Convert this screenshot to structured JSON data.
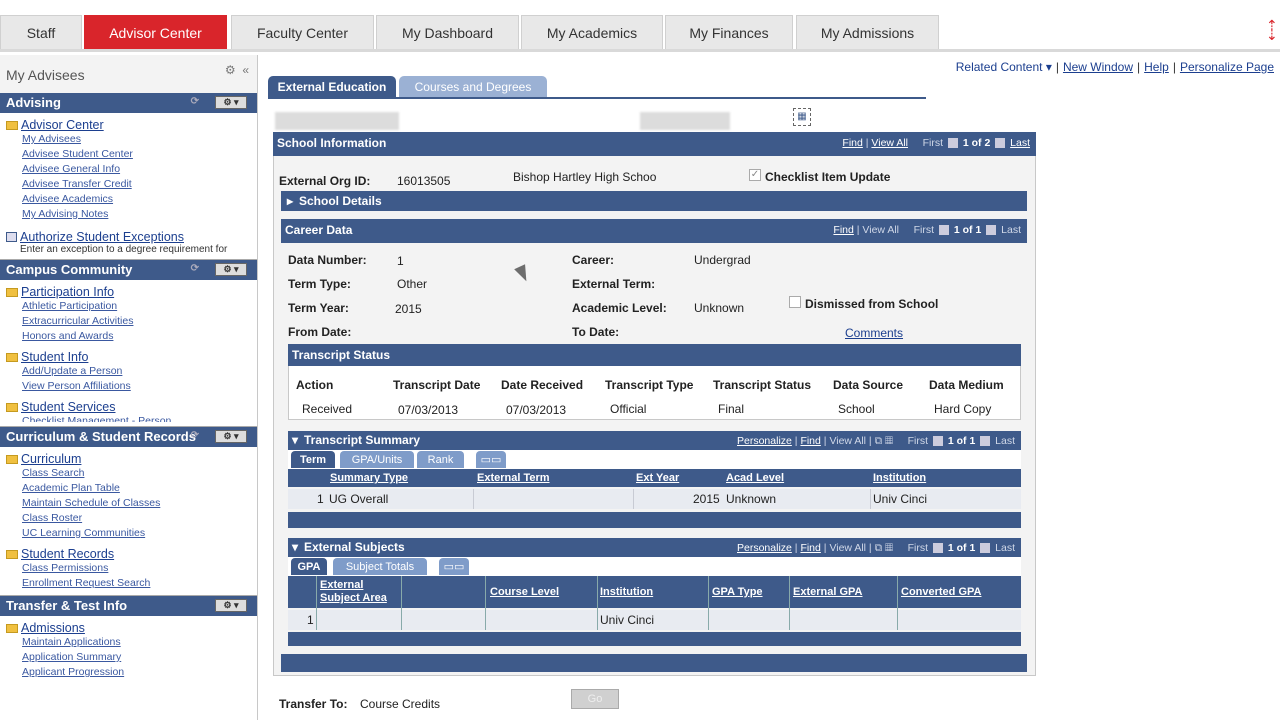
{
  "top_tabs": [
    "Staff",
    "Advisor Center",
    "Faculty Center",
    "My Dashboard",
    "My Academics",
    "My Finances",
    "My Admissions"
  ],
  "sidebar": {
    "title": "My Advisees",
    "advising": {
      "header": "Advising",
      "folder1": "Advisor Center",
      "links1": [
        "My Advisees",
        "Advisee Student Center",
        "Advisee General Info",
        "Advisee Transfer Credit",
        "Advisee Academics",
        "My Advising Notes"
      ],
      "folder2": "Authorize Student Exceptions",
      "note2": "Enter an exception to a degree requirement for"
    },
    "campus": {
      "header": "Campus Community",
      "folder1": "Participation Info",
      "links1": [
        "Athletic Participation",
        "Extracurricular Activities",
        "Honors and Awards"
      ],
      "folder2": "Student Info",
      "links2": [
        "Add/Update a Person",
        "View Person Affiliations"
      ],
      "folder3": "Student Services",
      "links3": [
        "Checklist Management - Person"
      ]
    },
    "curriculum": {
      "header": "Curriculum & Student Records",
      "folder1": "Curriculum",
      "links1": [
        "Class Search",
        "Academic Plan Table",
        "Maintain Schedule of Classes",
        "Class Roster",
        "UC Learning Communities"
      ],
      "folder2": "Student Records",
      "links2": [
        "Class Permissions",
        "Enrollment Request Search"
      ]
    },
    "transfer": {
      "header": "Transfer & Test Info",
      "folder1": "Admissions",
      "links1": [
        "Maintain Applications",
        "Application Summary",
        "Applicant Progression"
      ]
    }
  },
  "related": {
    "related_content": "Related Content",
    "new_window": "New Window",
    "help": "Help",
    "personalize": "Personalize Page"
  },
  "tabs": {
    "external_education": "External Education",
    "courses_degrees": "Courses and Degrees"
  },
  "school": {
    "header": "School Information",
    "find": "Find",
    "view_all": "View All",
    "first": "First",
    "count": "1 of 2",
    "last": "Last",
    "ext_org_label": "External Org ID:",
    "ext_org_value": "16013505",
    "school_name": "Bishop Hartley High Schoo",
    "checklist": "Checklist Item Update",
    "details": "School Details"
  },
  "career": {
    "header": "Career Data",
    "find": "Find",
    "view_all": "View All",
    "first": "First",
    "count": "1 of 1",
    "last": "Last",
    "data_number_label": "Data Number:",
    "data_number": "1",
    "career_label": "Career:",
    "career": "Undergrad",
    "term_type_label": "Term Type:",
    "term_type": "Other",
    "external_term_label": "External Term:",
    "term_year_label": "Term Year:",
    "term_year": "2015",
    "academic_level_label": "Academic Level:",
    "academic_level": "Unknown",
    "dismissed": "Dismissed from School",
    "from_date_label": "From Date:",
    "to_date_label": "To Date:",
    "comments": "Comments"
  },
  "transcript_status": {
    "header": "Transcript Status",
    "columns": [
      "Action",
      "Transcript Date",
      "Date Received",
      "Transcript Type",
      "Transcript Status",
      "Data Source",
      "Data Medium"
    ],
    "row": [
      "Received",
      "07/03/2013",
      "07/03/2013",
      "Official",
      "Final",
      "School",
      "Hard Copy"
    ]
  },
  "transcript_summary": {
    "header": "Transcript Summary",
    "personalize": "Personalize",
    "find": "Find",
    "view_all": "View All",
    "first": "First",
    "count": "1 of 1",
    "last": "Last",
    "subtabs": [
      "Term",
      "GPA/Units",
      "Rank"
    ],
    "columns": [
      "Summary Type",
      "External Term",
      "Ext Year",
      "Acad Level",
      "Institution"
    ],
    "row": {
      "num": "1",
      "summary_type": "UG Overall",
      "ext_year": "2015",
      "acad_level": "Unknown",
      "institution": "Univ Cinci"
    }
  },
  "external_subjects": {
    "header": "External Subjects",
    "personalize": "Personalize",
    "find": "Find",
    "view_all": "View All",
    "first": "First",
    "count": "1 of 1",
    "last": "Last",
    "subtabs": [
      "GPA",
      "Subject Totals"
    ],
    "columns": [
      "External Subject Area",
      "Course Level",
      "Institution",
      "GPA Type",
      "External GPA",
      "Converted GPA"
    ],
    "row": {
      "num": "1",
      "institution": "Univ Cinci"
    }
  },
  "transfer": {
    "label": "Transfer To:",
    "value": "Course Credits",
    "go": "Go"
  }
}
